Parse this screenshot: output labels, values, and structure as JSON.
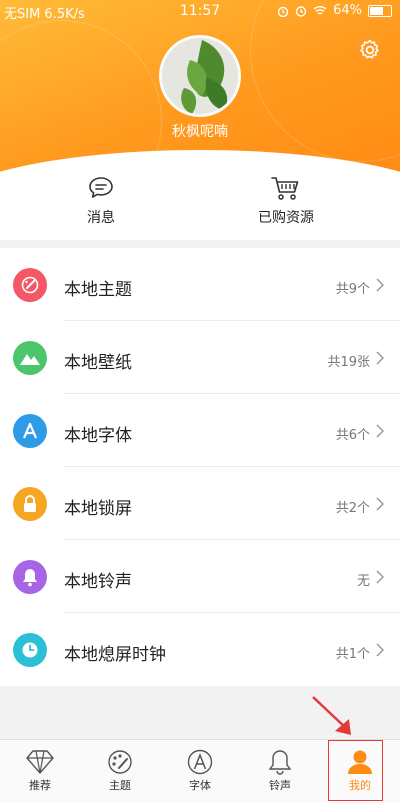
{
  "status_bar": {
    "carrier": "无SIM 6.5K/s",
    "time": "11:57",
    "battery": "64%"
  },
  "profile": {
    "username": "秋枫呢喃",
    "settings_icon": "gear-icon"
  },
  "quick_actions": [
    {
      "label": "消息",
      "icon": "message-icon"
    },
    {
      "label": "已购资源",
      "icon": "cart-icon"
    }
  ],
  "list": [
    {
      "label": "本地主题",
      "count": "共9个",
      "icon": "palette-icon",
      "color": "#f25866"
    },
    {
      "label": "本地壁纸",
      "count": "共19张",
      "icon": "mountain-icon",
      "color": "#4cc56c"
    },
    {
      "label": "本地字体",
      "count": "共6个",
      "icon": "letter-a-icon",
      "color": "#2f9be8"
    },
    {
      "label": "本地锁屏",
      "count": "共2个",
      "icon": "lock-icon",
      "color": "#f5a623"
    },
    {
      "label": "本地铃声",
      "count": "无",
      "icon": "bell-icon",
      "color": "#a765e6"
    },
    {
      "label": "本地熄屏时钟",
      "count": "共1个",
      "icon": "clock-icon",
      "color": "#2bc0d6"
    }
  ],
  "tabs": [
    {
      "label": "推荐",
      "icon": "diamond-icon",
      "active": false
    },
    {
      "label": "主题",
      "icon": "palette-icon",
      "active": false
    },
    {
      "label": "字体",
      "icon": "letter-a-icon",
      "active": false
    },
    {
      "label": "铃声",
      "icon": "bell-icon",
      "active": false
    },
    {
      "label": "我的",
      "icon": "person-icon",
      "active": true
    }
  ],
  "colors": {
    "accent": "#ff8a14",
    "highlight": "#e53935"
  }
}
